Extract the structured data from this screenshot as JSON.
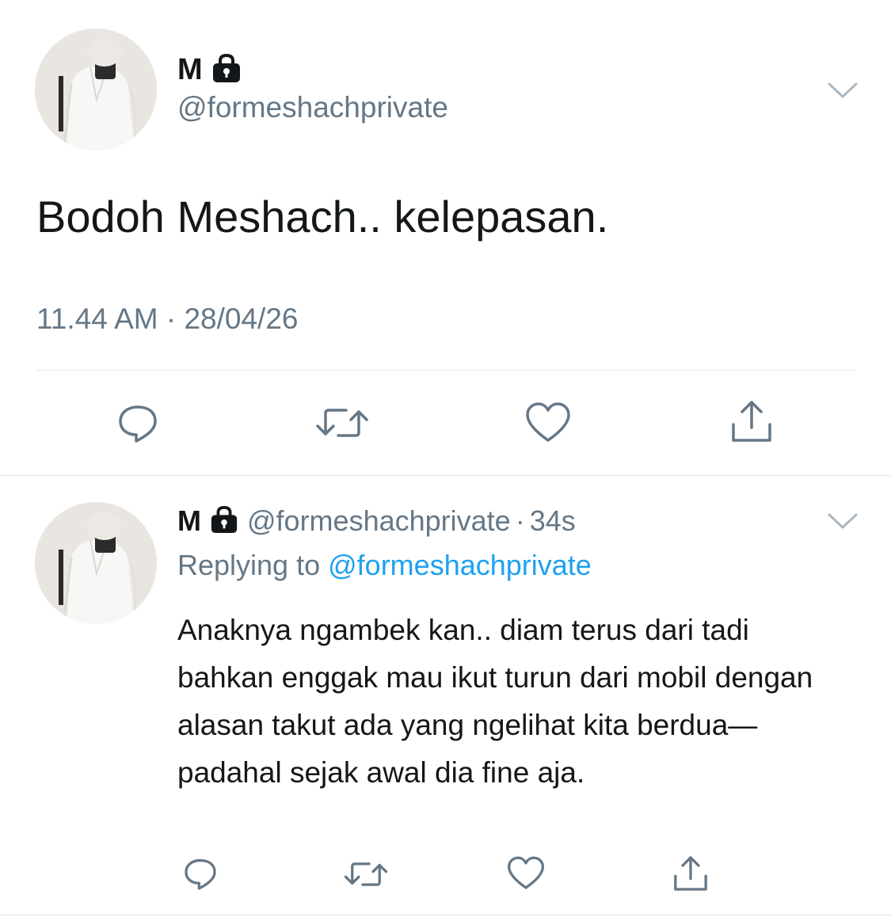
{
  "main_tweet": {
    "display_name": "M",
    "handle": "@formeshachprivate",
    "text": "Bodoh Meshach.. kelepasan.",
    "timestamp": "11.44 AM · 28/04/26",
    "avatar_icon": "avatar-photo",
    "protected_icon": "lock-icon",
    "menu_icon": "chevron-down-icon",
    "actions": {
      "reply_icon": "reply-icon",
      "retweet_icon": "retweet-icon",
      "like_icon": "heart-icon",
      "share_icon": "share-icon"
    }
  },
  "reply_tweet": {
    "display_name": "M",
    "handle": "@formeshachprivate",
    "separator": "·",
    "time": "34s",
    "replying_label": "Replying to",
    "replying_to": "@formeshachprivate",
    "text": "Anaknya ngambek kan.. diam terus dari tadi bahkan enggak mau ikut turun dari mobil dengan alasan takut ada yang ngelihat kita berdua—padahal sejak awal dia fine aja.",
    "avatar_icon": "avatar-photo",
    "protected_icon": "lock-icon",
    "menu_icon": "chevron-down-icon",
    "actions": {
      "reply_icon": "reply-icon",
      "retweet_icon": "retweet-icon",
      "like_icon": "heart-icon",
      "share_icon": "share-icon"
    }
  },
  "colors": {
    "text_primary": "#14171a",
    "text_secondary": "#657786",
    "link": "#1da1f2",
    "divider": "#e1e8ed"
  }
}
